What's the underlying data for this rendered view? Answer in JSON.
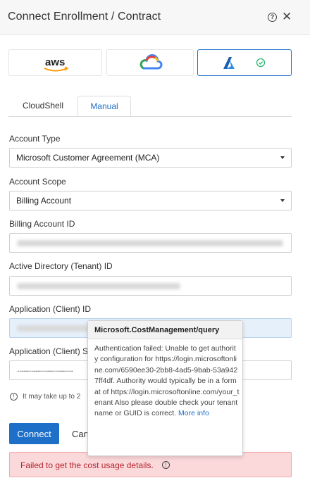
{
  "header": {
    "title": "Connect Enrollment / Contract"
  },
  "providers": [
    {
      "id": "aws",
      "label": "aws",
      "selected": false
    },
    {
      "id": "gcp",
      "selected": false
    },
    {
      "id": "azure",
      "selected": true
    }
  ],
  "tabs": [
    {
      "label": "CloudShell",
      "active": false
    },
    {
      "label": "Manual",
      "active": true
    }
  ],
  "form": {
    "account_type": {
      "label": "Account Type",
      "value": "Microsoft Customer Agreement (MCA)"
    },
    "account_scope": {
      "label": "Account Scope",
      "value": "Billing Account"
    },
    "billing_account_id": {
      "label": "Billing Account ID"
    },
    "tenant_id": {
      "label": "Active Directory (Tenant) ID"
    },
    "client_id": {
      "label": "Application (Client) ID"
    },
    "client_secret": {
      "label": "Application (Client) S",
      "value": "............................"
    }
  },
  "note": {
    "text": "It may take up to 2"
  },
  "buttons": {
    "connect": "Connect",
    "cancel": "Canc"
  },
  "error": {
    "message": "Failed to get the cost usage details."
  },
  "tooltip": {
    "title": "Microsoft.CostManagement/query",
    "body": "Authentication failed: Unable to get authority configuration for https://login.microsoftonline.com/6590ee30-2bb8-4ad5-9bab-53a9427ff4df. Authority would typically be in a format of https://login.microsoftonline.com/your_tenant Also please double check your tenant name or GUID is correct.",
    "link": "More info"
  },
  "colors": {
    "accent": "#1e6fc8",
    "error_bg": "#fbd8da",
    "error_text": "#b3262f",
    "success": "#2bb673"
  }
}
